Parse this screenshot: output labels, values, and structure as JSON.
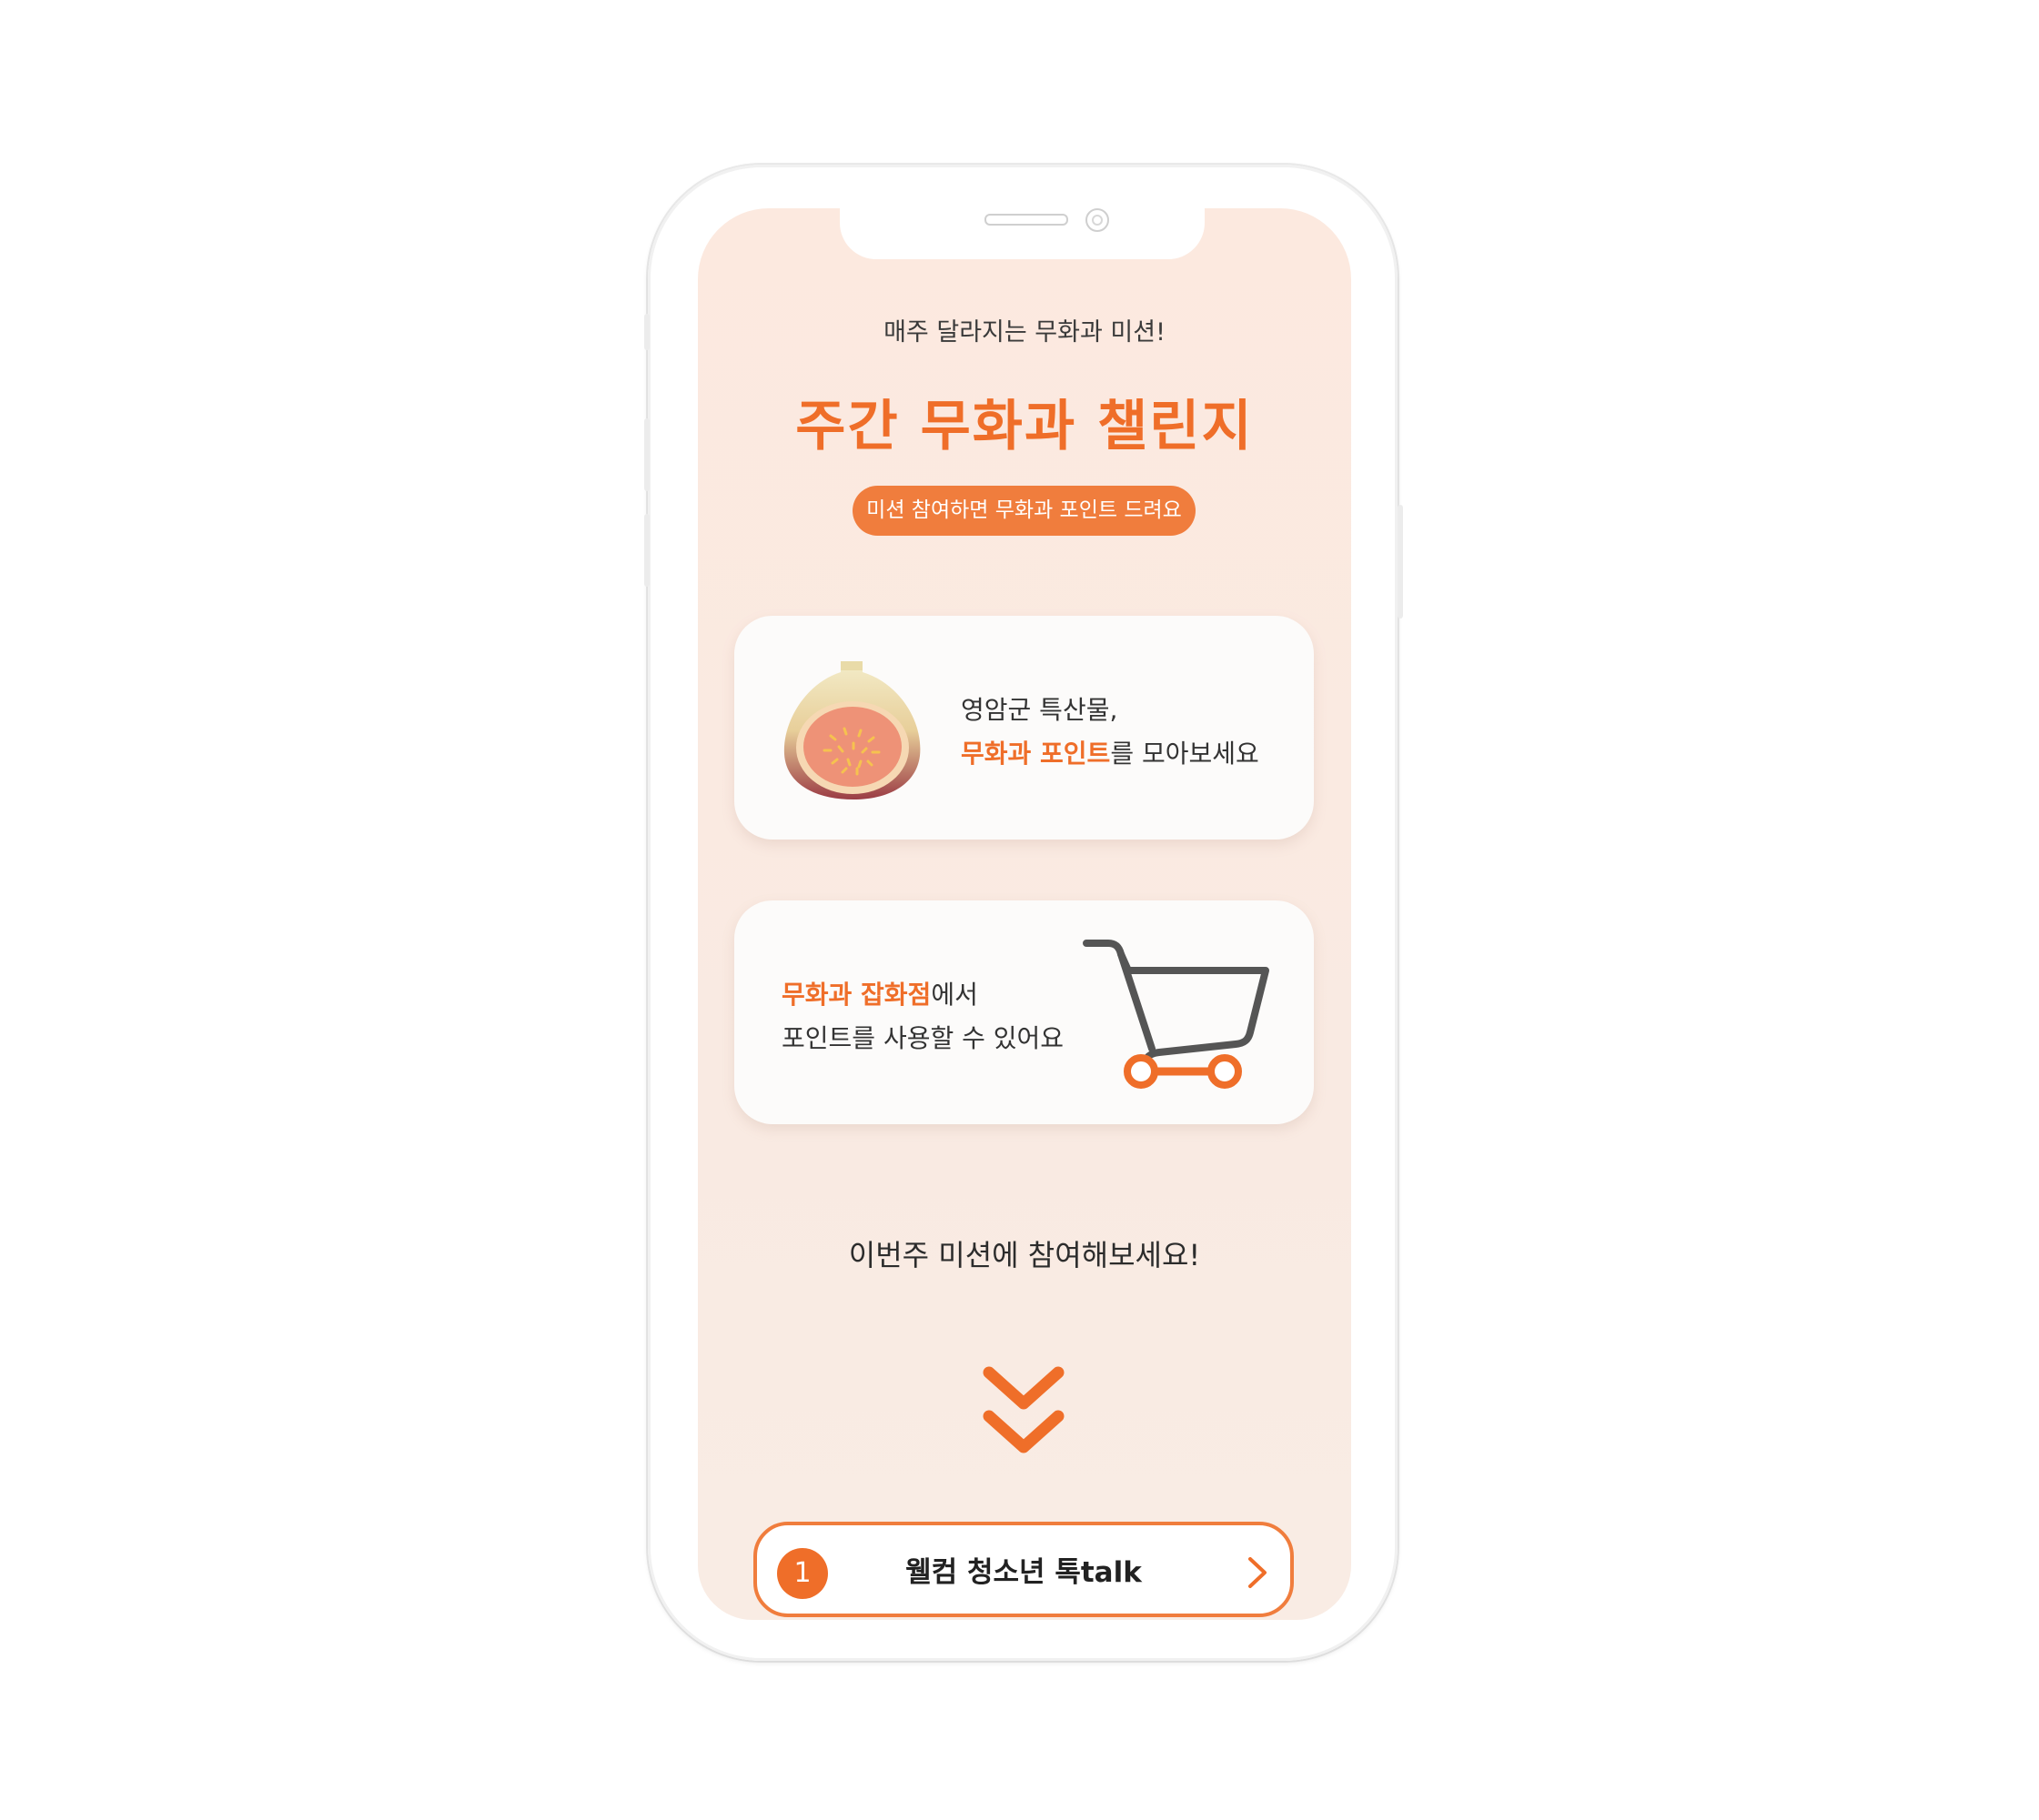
{
  "header": {
    "subtitle": "매주 달라지는 무화과 미션!",
    "title": "주간 무화과 챌린지",
    "badge": "미션 참여하면 무화과 포인트 드려요"
  },
  "cards": [
    {
      "icon": "fig-icon",
      "line1": "영암군 특산물,",
      "line2_highlight": "무화과 포인트",
      "line2_rest": "를 모아보세요"
    },
    {
      "icon": "cart-icon",
      "line1_highlight": "무화과 잡화점",
      "line1_rest": "에서",
      "line2": "포인트를 사용할 수 있어요"
    }
  ],
  "invite_text": "이번주 미션에 참여해보세요!",
  "scroll_icon": "double-chevron-down-icon",
  "missions": [
    {
      "number": "1",
      "label": "웰컴 청소년 톡talk",
      "arrow_icon": "chevron-right-icon"
    }
  ],
  "colors": {
    "accent": "#ef6e29",
    "badge": "#f07d3d",
    "screen_bg": "#fce9df",
    "card_bg": "#fcfbfa",
    "cart_body": "#555555"
  }
}
